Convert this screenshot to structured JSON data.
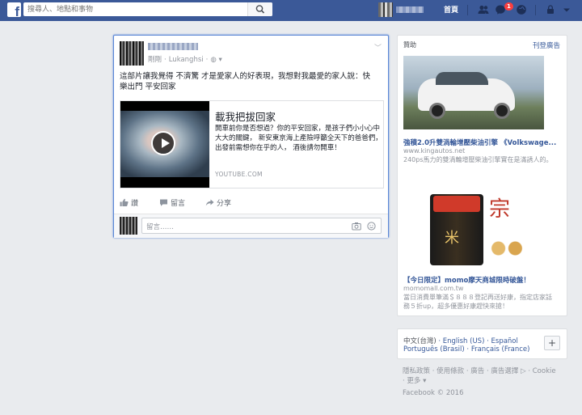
{
  "topbar": {
    "logo": "f",
    "search_placeholder": "搜尋人、地點和事物",
    "home_label": "首頁",
    "notification_count": "1"
  },
  "post": {
    "time": "剛剛",
    "location": "Lukanghsi",
    "text": "這部片讓我覺得 不濟驚 才是愛家人的好表現，我想對我最愛的家人說：快樂出門 平安回家",
    "link": {
      "title": "載我把拔回家",
      "description": "開車前你是否想過？你的平安回家，是孩子們小小心中 大大的關鍵， 新安東京海上產險呼籲全天下的爸爸們， 出發前需想你在乎的人， 酒後請勿開車！",
      "domain": "YOUTUBE.COM"
    },
    "actions": {
      "like": "讚",
      "comment": "留言",
      "share": "分享"
    },
    "comment_placeholder": "留言……"
  },
  "ads": {
    "header": "贊助",
    "create_link": "刊登廣告",
    "items": [
      {
        "title": "強積2.0升雙渦輪增壓柴油引擎 《Volkswage...",
        "url": "www.kingautos.net",
        "description": "240ps馬力的雙渦輪增壓柴油引擎實在是滿誘人的。"
      },
      {
        "title": "【今日限定】momo摩天商城限時破盤！",
        "url": "momomall.com.tw",
        "description": "當日消費單筆滿＄８８８登記再送好康，指定店家話務５折up，超多優惠好康趕快來搶！"
      }
    ]
  },
  "languages": {
    "line1": [
      "中文(台灣)",
      "English (US)",
      "Español"
    ],
    "line2": [
      "Português (Brasil)",
      "Français (France)"
    ],
    "add": "+"
  },
  "footer": {
    "line1": [
      "隱私政策",
      "使用條款",
      "廣告",
      "廣告選擇",
      "Cookie"
    ],
    "more": "更多",
    "copyright": "Facebook © 2016"
  }
}
